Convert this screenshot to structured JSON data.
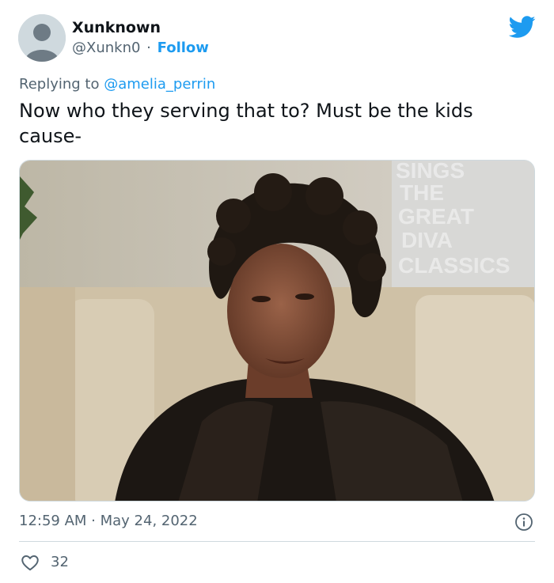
{
  "user": {
    "display_name": "Xunknown",
    "handle": "@Xunkn0",
    "separator": "·",
    "follow_label": "Follow"
  },
  "tweet": {
    "reply_prefix": "Replying to",
    "reply_to": "@amelia_perrin",
    "text": "Now who they serving that to? Must be the kids cause-",
    "timestamp": "12:59 AM · May 24, 2022",
    "like_count": "32"
  },
  "media": {
    "overlay_text_lines": [
      "SINGS",
      "THE",
      "GREAT",
      "DIVA",
      "CLASSICS"
    ]
  },
  "icons": {
    "brand": "twitter-bird-icon",
    "info": "info-icon",
    "like": "heart-icon"
  },
  "colors": {
    "accent": "#1d9bf0",
    "text_primary": "#0f1419",
    "text_secondary": "#536471",
    "divider": "#cfd9de"
  }
}
